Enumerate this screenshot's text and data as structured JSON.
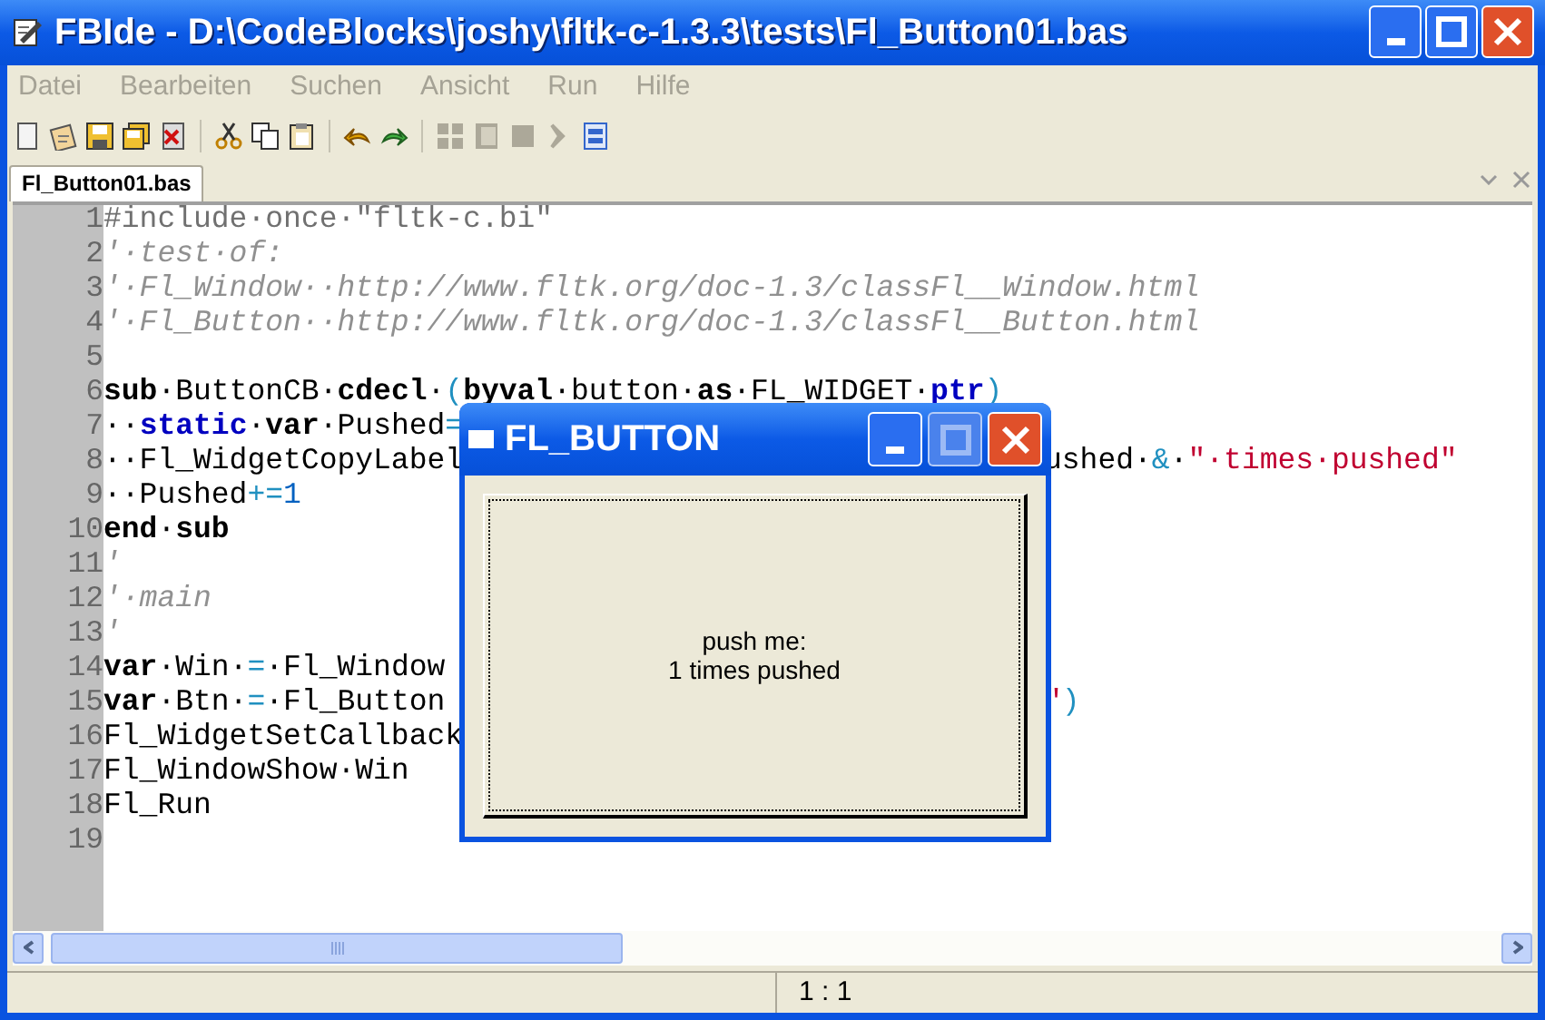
{
  "window": {
    "title": "FBIde - D:\\CodeBlocks\\joshy\\fltk-c-1.3.3\\tests\\Fl_Button01.bas"
  },
  "menu": [
    "Datei",
    "Bearbeiten",
    "Suchen",
    "Ansicht",
    "Run",
    "Hilfe"
  ],
  "tabs": [
    {
      "label": "Fl_Button01.bas",
      "selected": true
    }
  ],
  "editor": {
    "lines": [
      {
        "number": "1",
        "tokens": [
          {
            "kind": "preproc",
            "text": "#include·once·\"fltk-c.bi\""
          }
        ]
      },
      {
        "number": "2",
        "tokens": [
          {
            "kind": "comment",
            "text": "'·test·of:"
          }
        ]
      },
      {
        "number": "3",
        "tokens": [
          {
            "kind": "comment",
            "text": "'·Fl_Window··http://www.fltk.org/doc-1.3/classFl__Window.html"
          }
        ]
      },
      {
        "number": "4",
        "tokens": [
          {
            "kind": "comment",
            "text": "'·Fl_Button··http://www.fltk.org/doc-1.3/classFl__Button.html"
          }
        ]
      },
      {
        "number": "5"
      },
      {
        "number": "6",
        "tokens": [
          {
            "kind": "keyword",
            "text": "sub"
          },
          {
            "kind": "plain",
            "text": "·ButtonCB·"
          },
          {
            "kind": "keyword",
            "text": "cdecl"
          },
          {
            "kind": "plain",
            "text": "·"
          },
          {
            "kind": "op",
            "text": "("
          },
          {
            "kind": "keyword",
            "text": "byval"
          },
          {
            "kind": "plain",
            "text": "·button·"
          },
          {
            "kind": "keyword",
            "text": "as"
          },
          {
            "kind": "plain",
            "text": "·FL_WIDGET·"
          },
          {
            "kind": "type",
            "text": "ptr"
          },
          {
            "kind": "op",
            "text": ")"
          }
        ]
      },
      {
        "number": "7",
        "tokens": [
          {
            "kind": "plain",
            "text": "··"
          },
          {
            "kind": "type",
            "text": "static"
          },
          {
            "kind": "plain",
            "text": "·"
          },
          {
            "kind": "keyword",
            "text": "var"
          },
          {
            "kind": "plain",
            "text": "·Pushed"
          },
          {
            "kind": "op",
            "text": "="
          }
        ]
      },
      {
        "number": "8",
        "tokens": [
          {
            "kind": "plain",
            "text": "··Fl_WidgetCopyLabel"
          }
        ],
        "tail": [
          {
            "kind": "plain",
            "text": "ushed·"
          },
          {
            "kind": "op",
            "text": "&"
          },
          {
            "kind": "plain",
            "text": "·"
          },
          {
            "kind": "string",
            "text": "\"·times·pushed\""
          }
        ]
      },
      {
        "number": "9",
        "tokens": [
          {
            "kind": "plain",
            "text": "··Pushed"
          },
          {
            "kind": "op",
            "text": "+="
          },
          {
            "kind": "number",
            "text": "1"
          }
        ]
      },
      {
        "number": "10",
        "tokens": [
          {
            "kind": "keyword",
            "text": "end"
          },
          {
            "kind": "plain",
            "text": "·"
          },
          {
            "kind": "keyword",
            "text": "sub"
          }
        ]
      },
      {
        "number": "11",
        "tokens": [
          {
            "kind": "comment",
            "text": "'"
          }
        ]
      },
      {
        "number": "12",
        "tokens": [
          {
            "kind": "comment",
            "text": "'·main"
          }
        ]
      },
      {
        "number": "13",
        "tokens": [
          {
            "kind": "comment",
            "text": "'"
          }
        ]
      },
      {
        "number": "14",
        "tokens": [
          {
            "kind": "keyword",
            "text": "var"
          },
          {
            "kind": "plain",
            "text": "·Win·"
          },
          {
            "kind": "op",
            "text": "="
          },
          {
            "kind": "plain",
            "text": "·Fl_Window"
          }
        ]
      },
      {
        "number": "15",
        "tokens": [
          {
            "kind": "keyword",
            "text": "var"
          },
          {
            "kind": "plain",
            "text": "·Btn·"
          },
          {
            "kind": "op",
            "text": "="
          },
          {
            "kind": "plain",
            "text": "·Fl_Button"
          }
        ],
        "tail": [
          {
            "kind": "string",
            "text": "\""
          },
          {
            "kind": "op",
            "text": ")"
          }
        ]
      },
      {
        "number": "16",
        "tokens": [
          {
            "kind": "plain",
            "text": "Fl_WidgetSetCallback"
          }
        ]
      },
      {
        "number": "17",
        "tokens": [
          {
            "kind": "plain",
            "text": "Fl_WindowShow·Win"
          }
        ]
      },
      {
        "number": "18",
        "tokens": [
          {
            "kind": "plain",
            "text": "Fl_Run"
          }
        ]
      },
      {
        "number": "19"
      }
    ]
  },
  "dialog": {
    "title": "FL_BUTTON",
    "button_label": "push me:\n1 times pushed"
  },
  "status_bar": {
    "position": "1 : 1"
  }
}
